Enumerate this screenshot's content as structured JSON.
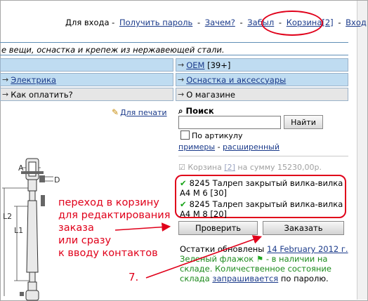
{
  "header": {
    "login_prefix": "Для входа -",
    "get_password": "Получить пароль",
    "dash": "-",
    "why": "Зачем?",
    "forgot": "Забыл",
    "cart": "Корзина",
    "cart_count": "[2]",
    "login": "Вход"
  },
  "tagline": "е вещи, оснастка и крепеж из нержавеющей стали.",
  "nav": {
    "electrics": "Электрика",
    "oem": "OEM",
    "oem_count": "[39+]",
    "rigging": "Оснастка и аксессуары",
    "how_pay": "Как оплатить?",
    "about": "О магазине"
  },
  "print_link": "Для печати",
  "search": {
    "title": "Поиск",
    "find_button": "Найти",
    "by_article": "По артикулу",
    "examples": "примеры",
    "dash": "-",
    "advanced": "расширенный"
  },
  "cart_summary": {
    "label": "Корзина",
    "count": "[2]",
    "sum": "на сумму 15230,00р."
  },
  "cart_items": [
    {
      "line1": "8245 Талреп закрытый вилка-вилка",
      "line2": "А4 М 6 [30]"
    },
    {
      "line1": "8245 Талреп закрытый вилка-вилка",
      "line2": "А4 М 8 [20]"
    }
  ],
  "buttons": {
    "check": "Проверить",
    "order": "Заказать"
  },
  "stock": {
    "updated_prefix": "Остатки обновлены",
    "updated_date": "14 February 2012 г.",
    "green_flag": "Зеленый флажок",
    "in_stock": "- в наличии на складе. Количественное состояние склада",
    "ask": "запрашивается",
    "by_password": "по паролю."
  },
  "annotation": {
    "line1": "переход в корзину",
    "line2": "для редактирования",
    "line3": "заказа",
    "line4": "или сразу",
    "line5": "к вводу контактов",
    "step": "7."
  },
  "drawing": {
    "A": "A",
    "D": "D",
    "L1": "L1",
    "L2": "L2"
  },
  "colors": {
    "nav_blue": "#bfdcf1",
    "nav_gray": "#e6e6e6",
    "annotation_red": "#e0001a",
    "link_blue": "#1a3a8a",
    "check_green": "#18a418"
  }
}
